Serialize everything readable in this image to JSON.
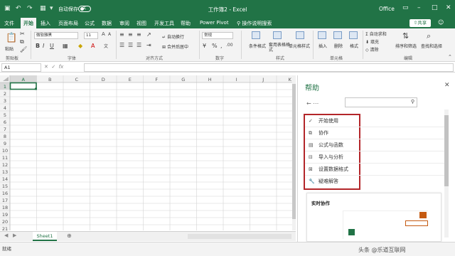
{
  "title_bar": {
    "autosave_label": "自动保存",
    "autosave_state": "关",
    "document_title": "工作簿2 - Excel",
    "office_label": "Office"
  },
  "ribbon_tabs": [
    "文件",
    "开始",
    "插入",
    "页面布局",
    "公式",
    "数据",
    "审阅",
    "视图",
    "开发工具",
    "帮助",
    "Power Pivot"
  ],
  "search_tab": "操作说明搜索",
  "share_label": "共享",
  "ribbon": {
    "clipboard": {
      "paste": "粘贴",
      "group": "剪贴板"
    },
    "font": {
      "name": "微软雅黑",
      "size": "11",
      "group": "字体"
    },
    "alignment": {
      "wrap": "自动换行",
      "merge": "合并后居中",
      "group": "对齐方式"
    },
    "number": {
      "format": "常规",
      "group": "数字"
    },
    "styles": {
      "conditional": "条件格式",
      "table": "套用表格格式",
      "cell_styles": "单元格样式",
      "group": "样式"
    },
    "cells": {
      "insert": "插入",
      "delete": "删除",
      "format": "格式",
      "group": "单元格"
    },
    "editing": {
      "autosum": "自动求和",
      "fill": "填充",
      "clear": "清除",
      "sort": "排序和筛选",
      "find": "查找和选择",
      "group": "编辑"
    }
  },
  "name_box": "A1",
  "columns": [
    "A",
    "B",
    "C",
    "D",
    "E",
    "F",
    "G",
    "H",
    "I",
    "J",
    "K"
  ],
  "rows": [
    "1",
    "2",
    "3",
    "4",
    "5",
    "6",
    "7",
    "8",
    "9",
    "10",
    "11",
    "12",
    "13",
    "14",
    "15",
    "16",
    "17",
    "18",
    "19",
    "20",
    "21"
  ],
  "sheet_tab": "Sheet1",
  "status_text": "就绪",
  "help_pane": {
    "title": "帮助",
    "items": [
      {
        "label": "开始使用",
        "icon": "check-icon"
      },
      {
        "label": "协作",
        "icon": "collaborate-icon"
      },
      {
        "label": "公式与函数",
        "icon": "formula-icon"
      },
      {
        "label": "导入与分析",
        "icon": "import-icon"
      },
      {
        "label": "设置数据格式",
        "icon": "format-icon"
      },
      {
        "label": "疑难解答",
        "icon": "wrench-icon"
      }
    ],
    "card_title": "实时协作"
  },
  "watermark": "头条 @乐道互联网",
  "colors": {
    "accent": "#217346",
    "highlight_border": "#b3262a"
  }
}
